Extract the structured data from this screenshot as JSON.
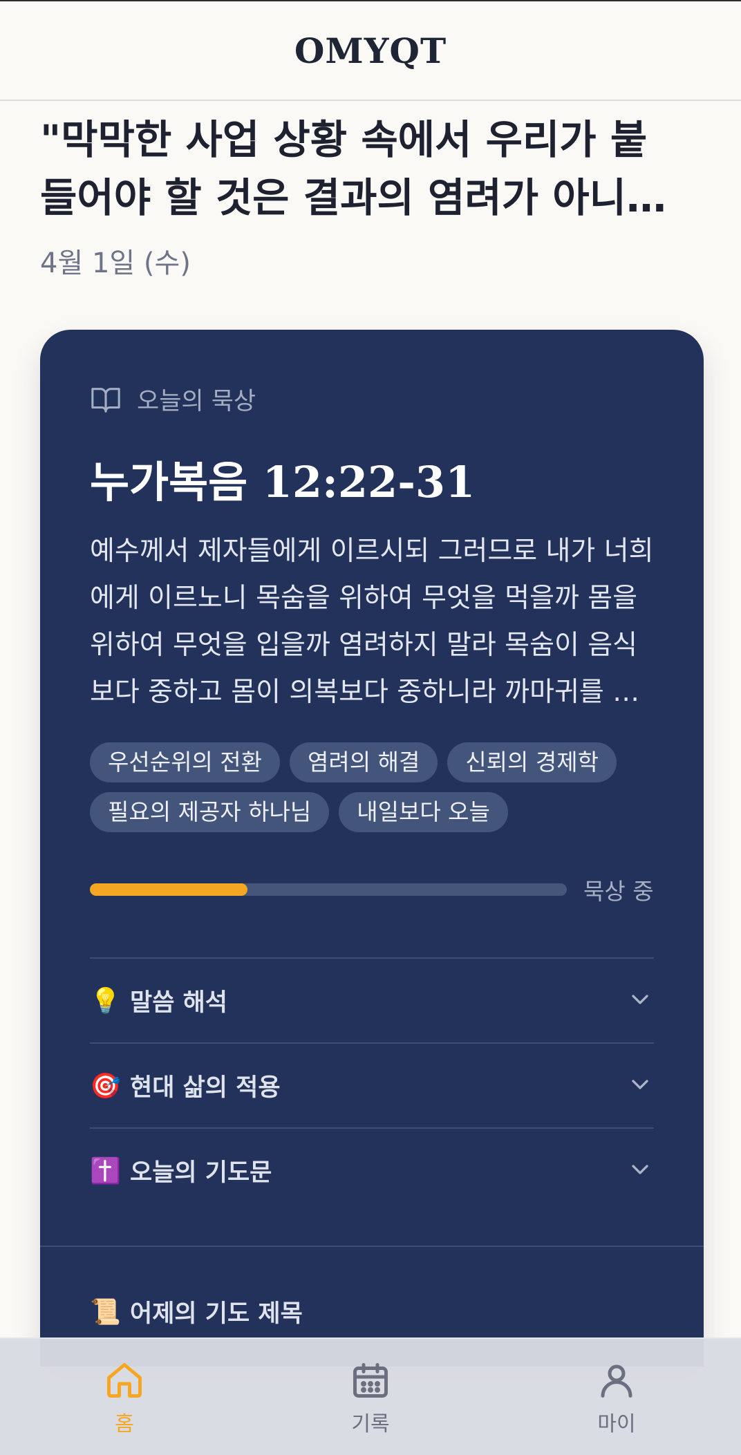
{
  "header": {
    "title": "OMYQT"
  },
  "headline": {
    "line1": "\"막막한 사업 상황 속에서 우리가 붙",
    "line2": "들어야 할 것은 결과의 염려가 아니…"
  },
  "date": "4월 1일 (수)",
  "card": {
    "section_label": "오늘의 묵상",
    "section_icon": "book-open-icon",
    "verse_ref": "누가복음 12:22-31",
    "verse_lines": [
      "예수께서 제자들에게 이르시되 그러므로 내가 너희",
      "에게 이르노니 목숨을 위하여 무엇을 먹을까 몸을",
      "위하여 무엇을 입을까 염려하지 말라 목숨이 음식",
      "보다 중하고 몸이 의복보다 중하니라 까마귀를 …"
    ],
    "tags": [
      "우선순위의 전환",
      "염려의 해결",
      "신뢰의 경제학",
      "필요의 제공자 하나님",
      "내일보다 오늘"
    ],
    "progress": {
      "value": 0.33,
      "label": "묵상 중",
      "fill_color": "#f5a623"
    },
    "accordions": [
      {
        "emoji": "💡",
        "title": "말씀 해석"
      },
      {
        "emoji": "🎯",
        "title": "현대 삶의 적용"
      },
      {
        "emoji": "✝️",
        "title": "오늘의 기도문"
      }
    ],
    "yesterday": {
      "emoji": "📜",
      "title": "어제의 기도 제목"
    }
  },
  "nav": {
    "items": [
      {
        "label": "홈",
        "icon": "home-icon",
        "active": true
      },
      {
        "label": "기록",
        "icon": "calendar-icon",
        "active": false
      },
      {
        "label": "마이",
        "icon": "user-icon",
        "active": false
      }
    ]
  },
  "colors": {
    "card_bg": "#22325b",
    "accent": "#f5a623",
    "page_bg": "#fbf9f5"
  }
}
